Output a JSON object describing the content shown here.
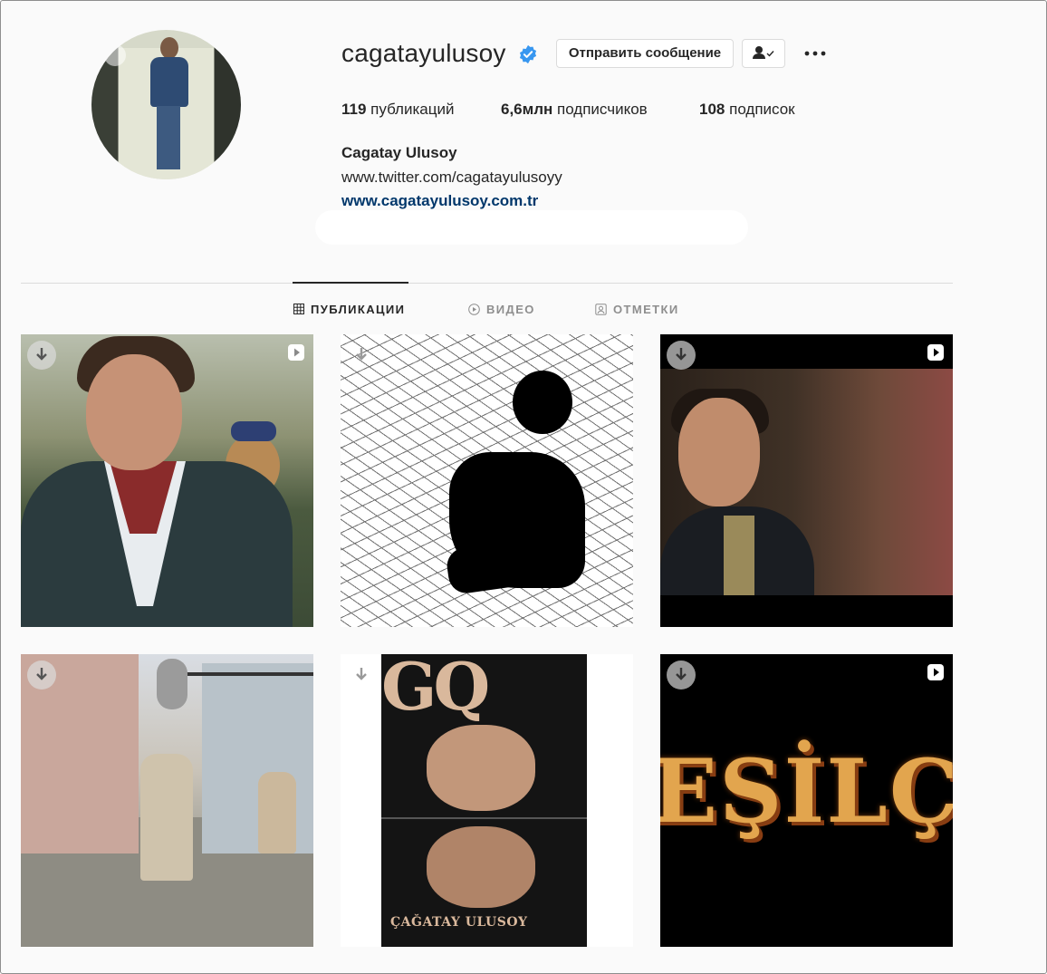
{
  "profile": {
    "username": "cagatayulusoy",
    "verified": true,
    "message_button": "Отправить сообщение",
    "stats": {
      "posts_value": "119",
      "posts_label": "публикаций",
      "followers_value": "6,6млн",
      "followers_label": "подписчиков",
      "following_value": "108",
      "following_label": "подписок"
    },
    "full_name": "Cagatay Ulusoy",
    "bio_link_1": "www.twitter.com/cagatayulusoyy",
    "bio_link_2": "www.cagatayulusoy.com.tr"
  },
  "tabs": [
    {
      "label": "ПУБЛИКАЦИИ",
      "icon": "grid-icon",
      "active": true
    },
    {
      "label": "ВИДЕО",
      "icon": "play-circle-icon",
      "active": false
    },
    {
      "label": "ОТМЕТКИ",
      "icon": "tag-icon",
      "active": false
    }
  ],
  "posts": [
    {
      "type": "video"
    },
    {
      "type": "image"
    },
    {
      "type": "video"
    },
    {
      "type": "image"
    },
    {
      "type": "image",
      "cover_brand": "GQ",
      "cover_title": "ÇAĞATAY ULUSOY"
    },
    {
      "type": "video",
      "marquee_text": "EŞİLÇA"
    }
  ],
  "colors": {
    "verified_blue": "#3897f0",
    "link_blue": "#00376b",
    "divider": "#dbdbdb"
  }
}
